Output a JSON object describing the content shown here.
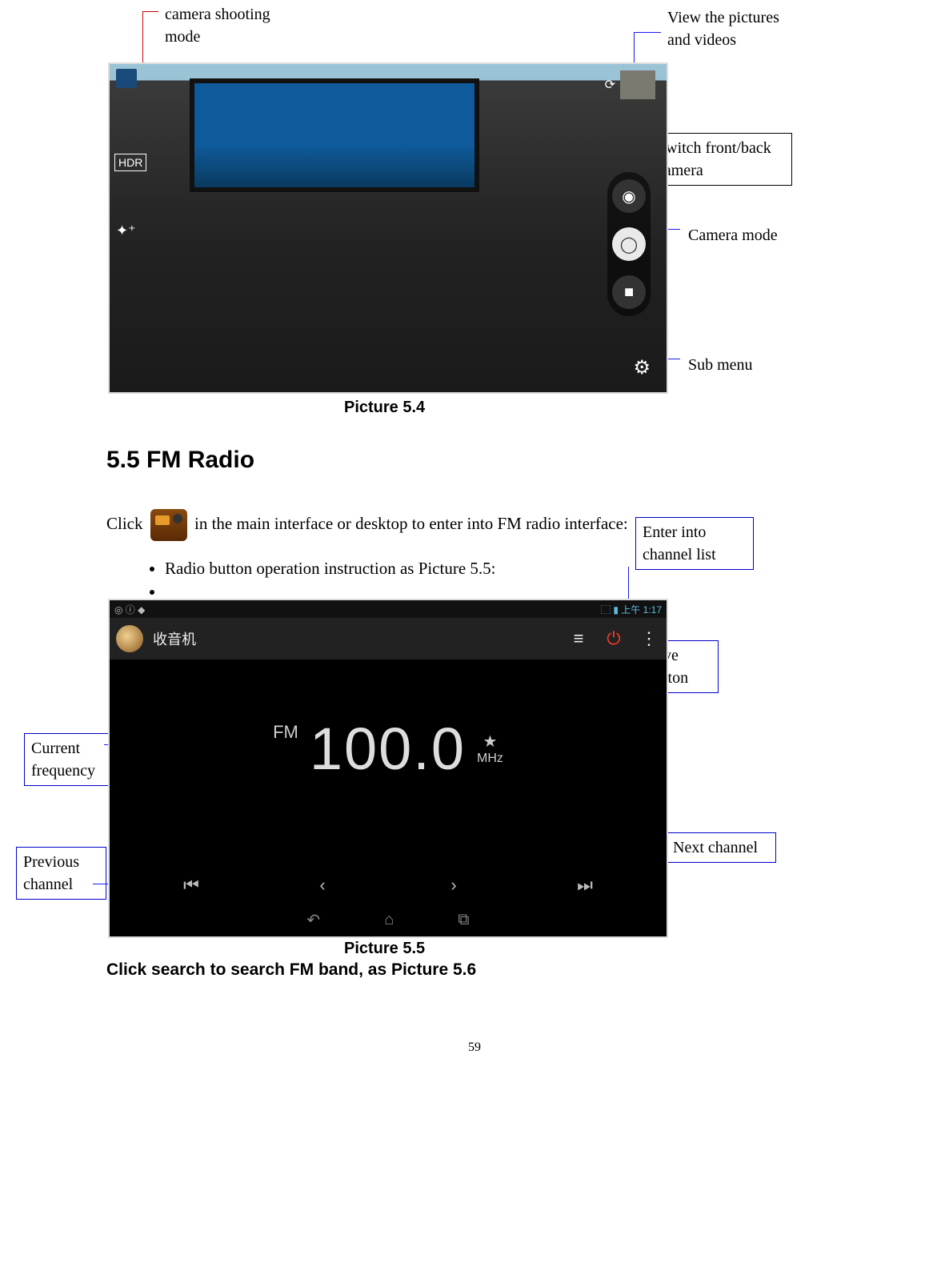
{
  "callouts_54": {
    "camera_shooting_mode": "camera  shooting mode",
    "view_pics": "View the pictures and videos",
    "switch_cam": "Switch front/back camera",
    "camera_mode": "Camera mode",
    "sub_menu": "Sub menu"
  },
  "pic54": {
    "hdr": "HDR",
    "fx": "✦⁺",
    "switch_icon": "⟳",
    "shutter_icon": "◉",
    "photo_icon": "◯",
    "video_icon": "■",
    "gear_icon": "⚙",
    "caption": "Picture 5.4"
  },
  "section": {
    "title": "5.5 FM Radio",
    "intro_pre": "Click",
    "intro_post": " in the main interface or desktop to enter into FM radio interface:",
    "bullet1": "Radio button operation instruction as Picture 5.5:"
  },
  "callouts_55": {
    "enter_list": "Enter into channel list",
    "save": "Save button",
    "next": "Next channel",
    "current": "Current frequency",
    "prev": "Previous channel"
  },
  "pic55": {
    "status_left_icons": "◎ ⓘ ◆",
    "status_right": "⬚ ▮ 上午 1:17",
    "app_title": "收音机",
    "list_icon": "≡",
    "power_icon": "⏻",
    "overflow_icon": "⋮",
    "fm_label": "FM",
    "freq_value": "100.0",
    "star": "★",
    "mhz_label": "MHz",
    "prev_ch": "⏮",
    "prev": "‹",
    "next": "›",
    "next_ch": "⏭",
    "nav_back": "↶",
    "nav_home": "⌂",
    "nav_recent": "⧉",
    "caption": "Picture 5.5",
    "after": "Click search to search FM band, as Picture 5.6"
  },
  "page_number": "59"
}
